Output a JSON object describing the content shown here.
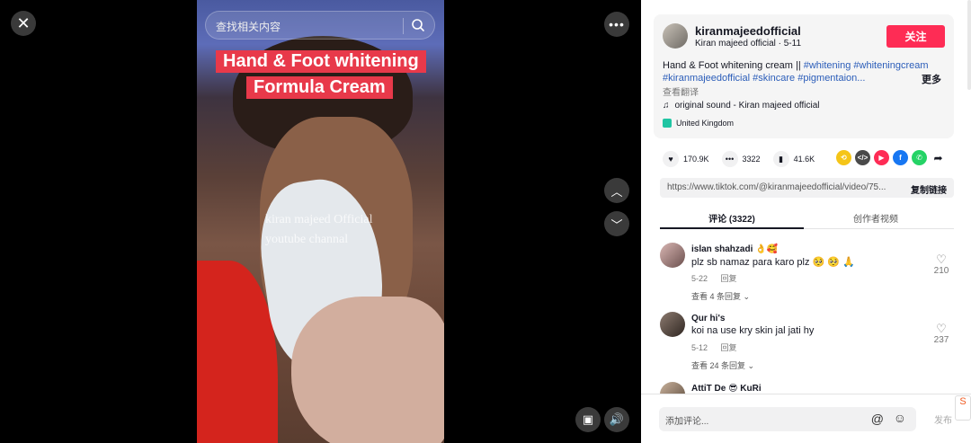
{
  "video": {
    "search_placeholder": "查找相关内容",
    "caption_line1": "Hand & Foot whitening",
    "caption_line2": "Formula Cream",
    "watermark_line1": "kiran majeed Official",
    "watermark_line2": "youtube channal"
  },
  "author": {
    "username": "kiranmajeedofficial",
    "subline": "Kiran majeed official · 5-11",
    "follow_label": "关注"
  },
  "description": {
    "text": "Hand & Foot whitening cream || ",
    "tags": [
      "#whitening",
      "#whiteningcream",
      "#kiranmajeedofficial",
      "#skincare",
      "#pigmentaion..."
    ],
    "more_label": "更多",
    "translate_label": "查看翻译"
  },
  "sound": {
    "label": "original sound - Kiran majeed official"
  },
  "region": {
    "label": "United Kingdom"
  },
  "stats": {
    "likes": "170.9K",
    "comments": "3322",
    "saves": "41.6K"
  },
  "share_icons": [
    "repost-icon",
    "embed-icon",
    "send-icon",
    "facebook-icon",
    "whatsapp-icon",
    "share-arrow-icon"
  ],
  "link": {
    "url": "https://www.tiktok.com/@kiranmajeedofficial/video/75...",
    "copy_label": "复制链接"
  },
  "tabs": {
    "comments": "评论 (3322)",
    "creator_videos": "创作者视频"
  },
  "comments": [
    {
      "name": "islan  shahzadi 👌🥰",
      "text": "plz sb namaz para karo plz 🥺 🥺 🙏",
      "date": "5-22",
      "reply_label": "回复",
      "replies": "查看 4 条回复",
      "likes": "210"
    },
    {
      "name": "Qur  hi's",
      "text": "koi na use kry skin jal jati hy",
      "date": "5-12",
      "reply_label": "回复",
      "replies": "查看 24 条回复",
      "likes": "237"
    },
    {
      "name": "AttiT  De 😎 KuRi"
    }
  ],
  "comment_bar": {
    "placeholder": "添加评论...",
    "post_label": "发布"
  },
  "colors": {
    "accent": "#fe2c55",
    "tag": "#2b5db9",
    "caption_bg": "#e8394a"
  }
}
